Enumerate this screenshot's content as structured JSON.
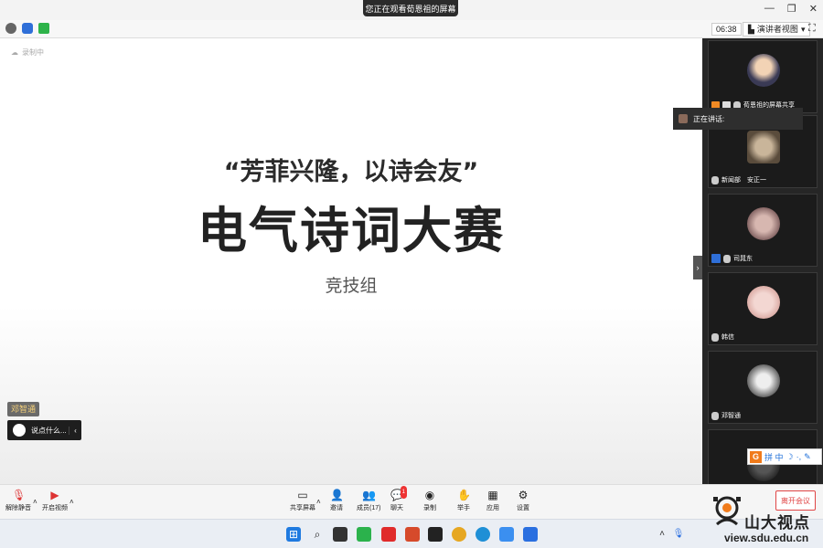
{
  "banner": {
    "text": "您正在观看荀恩祖的屏幕"
  },
  "meetbar": {
    "timer": "06:38",
    "view_label": "演讲者视图"
  },
  "slide": {
    "recording_label": "录制中",
    "quote_line": "“芳菲兴隆，以诗会友”",
    "title": "电气诗词大赛",
    "subtitle": "竞技组"
  },
  "self": {
    "name_tag": "邓智通",
    "chat_placeholder": "说点什么..."
  },
  "speaking": {
    "label": "正在讲话:"
  },
  "participants": [
    {
      "name": "荀恩祖的屏幕共享"
    },
    {
      "name": "新闻部　安正一"
    },
    {
      "name": "司晁东"
    },
    {
      "name": "韩信"
    },
    {
      "name": "邓智通"
    },
    {
      "name": ""
    }
  ],
  "controls": {
    "unmute": "解除静音",
    "start_video": "开启视频",
    "share_screen": "共享屏幕",
    "invite": "邀请",
    "members": "成员(17)",
    "chat": "聊天",
    "record": "录制",
    "raise_hand": "举手",
    "apps": "应用",
    "settings": "设置",
    "leave": "离开会议",
    "chat_badge": "1"
  },
  "ime": {
    "mode": "拼 中"
  },
  "watermark": {
    "name": "山大视点",
    "url": "view.sdu.edu.cn"
  },
  "colors": {
    "leave_red": "#e04545",
    "ime_orange": "#f07b1b",
    "panel_bg": "#262626"
  }
}
